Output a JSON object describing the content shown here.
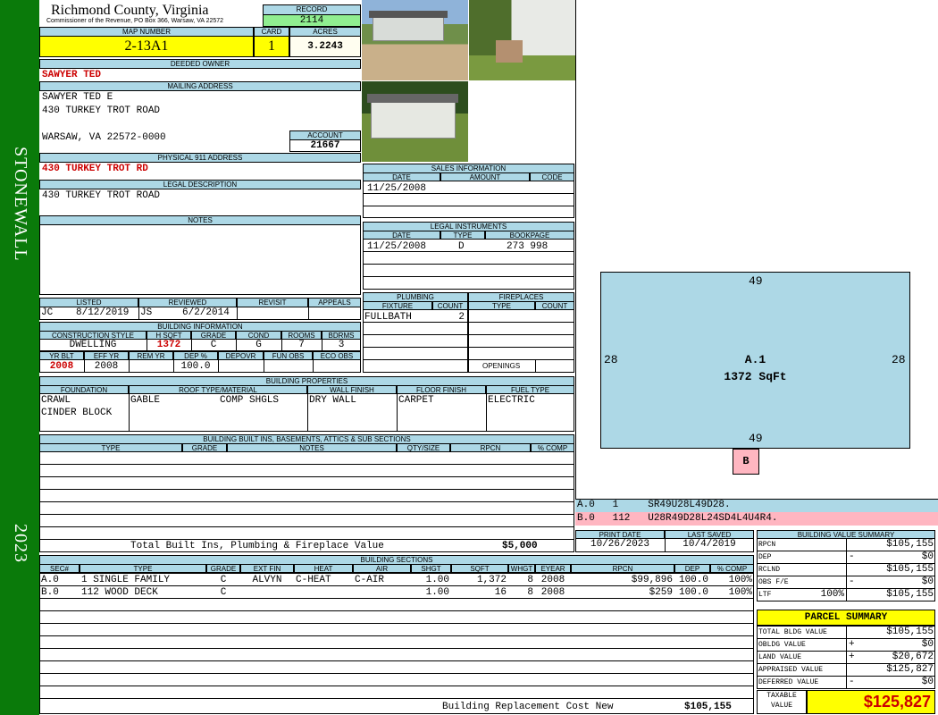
{
  "sidebar": {
    "district": "STONEWALL",
    "year": "2023"
  },
  "header": {
    "county": "Richmond County, Virginia",
    "commissioner": "Commissioner of the Revenue, PO Box 366, Warsaw, VA 22572",
    "record_label": "RECORD",
    "record": "2114",
    "map_number_label": "MAP NUMBER",
    "map_number": "2-13A1",
    "card_label": "CARD",
    "card": "1",
    "acres_label": "ACRES",
    "acres": "3.2243"
  },
  "owner": {
    "deeded_label": "DEEDED OWNER",
    "deeded_owner": "SAWYER TED",
    "mailing_label": "MAILING ADDRESS",
    "mailing_line1": "SAWYER TED E",
    "mailing_line2": "430 TURKEY TROT ROAD",
    "mailing_line3": "WARSAW, VA 22572-0000",
    "account_label": "ACCOUNT",
    "account": "21667",
    "physical_label": "PHYSICAL 911 ADDRESS",
    "physical": "430 TURKEY TROT RD",
    "legal_label": "LEGAL DESCRIPTION",
    "legal": "430 TURKEY TROT ROAD",
    "notes_label": "NOTES"
  },
  "sales": {
    "title": "SALES INFORMATION",
    "h_date": "DATE",
    "h_amount": "AMOUNT",
    "h_code": "CODE",
    "date1": "11/25/2008"
  },
  "legal_instruments": {
    "title": "LEGAL INSTRUMENTS",
    "h_date": "DATE",
    "h_type": "TYPE",
    "h_bookpage": "BOOKPAGE",
    "date1": "11/25/2008",
    "type1": "D",
    "bookpage1": "273 998"
  },
  "status": {
    "h_listed": "LISTED",
    "h_reviewed": "REVIEWED",
    "h_revisit": "REVISIT",
    "h_appeals": "APPEALS",
    "listed_by": "JC",
    "listed_date": "8/12/2019",
    "reviewed_by": "JS",
    "reviewed_date": "6/2/2014"
  },
  "building_info": {
    "title": "BUILDING INFORMATION",
    "h_style": "CONSTRUCTION STYLE",
    "h_hsqft": "H SQFT",
    "h_grade": "GRADE",
    "h_cond": "COND",
    "h_rooms": "ROOMS",
    "h_bdrms": "BDRMS",
    "style": "DWELLING",
    "hsqft": "1372",
    "grade": "C",
    "cond": "G",
    "rooms": "7",
    "bdrms": "3",
    "h_yrblt": "YR BLT",
    "h_effyr": "EFF YR",
    "h_remyr": "REM YR",
    "h_dep": "DEP %",
    "h_depovr": "DEPOVR",
    "h_funobs": "FUN OBS",
    "h_ecoobs": "ECO OBS",
    "yrblt": "2008",
    "effyr": "2008",
    "dep": "100.0"
  },
  "plumbing": {
    "title": "PLUMBING",
    "h_fixture": "FIXTURE",
    "h_count": "COUNT",
    "fixture1": "FULLBATH",
    "count1": "2"
  },
  "fireplaces": {
    "title": "FIREPLACES",
    "h_type": "TYPE",
    "h_count": "COUNT",
    "openings": "OPENINGS"
  },
  "properties": {
    "title": "BUILDING PROPERTIES",
    "h_foundation": "FOUNDATION",
    "h_roof": "ROOF TYPE/MATERIAL",
    "h_wall": "WALL FINISH",
    "h_floor": "FLOOR FINISH",
    "h_fuel": "FUEL TYPE",
    "foundation1": "CRAWL",
    "foundation2": "CINDER BLOCK",
    "roof_type": "GABLE",
    "roof_material": "COMP SHGLS",
    "wall": "DRY WALL",
    "floor": "CARPET",
    "fuel": "ELECTRIC"
  },
  "builtins": {
    "title": "BUILDING BUILT INS, BASEMENTS, ATTICS & SUB SECTIONS",
    "h_type": "TYPE",
    "h_grade": "GRADE",
    "h_notes": "NOTES",
    "h_qty": "QTY/SIZE",
    "h_rpcn": "RPCN",
    "h_comp": "% COMP",
    "total_label": "Total Built Ins, Plumbing & Fireplace Value",
    "total_value": "$5,000"
  },
  "dates": {
    "h_print": "PRINT DATE",
    "h_saved": "LAST SAVED",
    "print_date": "10/26/2023",
    "last_saved": "10/4/2019"
  },
  "sketch": {
    "top": "49",
    "bottom": "49",
    "left": "28",
    "right": "28",
    "label": "A.1",
    "area": "1372 SqFt",
    "deck_label": "B",
    "code_a": "A.0   1     SR49U28L49D28.",
    "code_b": "B.0   112   U28R49D28L24SD4L4U4R4.",
    "fill_color": "#add8e6",
    "deck_color": "#ffb6c1"
  },
  "sections": {
    "title": "BUILDING SECTIONS",
    "headers": [
      "SEC#",
      "TYPE",
      "GRADE",
      "EXT FIN",
      "HEAT",
      "AIR",
      "SHGT",
      "SQFT",
      "WHGT",
      "EYEAR",
      "RPCN",
      "DEP",
      "% COMP"
    ],
    "rows": [
      {
        "sec": "A.0",
        "type": "1 SINGLE FAMILY",
        "grade": "C",
        "extfin": "ALVYN",
        "heat": "C-HEAT",
        "air": "C-AIR",
        "shgt": "1.00",
        "sqft": "1,372",
        "whgt": "8",
        "eyear": "2008",
        "rpcn": "$99,896",
        "dep": "100.0",
        "comp": "100%"
      },
      {
        "sec": "B.0",
        "type": "112 WOOD DECK",
        "grade": "C",
        "extfin": "",
        "heat": "",
        "air": "",
        "shgt": "1.00",
        "sqft": "16",
        "whgt": "8",
        "eyear": "2008",
        "rpcn": "$259",
        "dep": "100.0",
        "comp": "100%"
      }
    ],
    "replacement_label": "Building Replacement Cost New",
    "replacement_value": "$105,155"
  },
  "value_summary": {
    "title": "BUILDING VALUE SUMMARY",
    "rpcn_label": "RPCN",
    "rpcn": "$105,155",
    "dep_label": "DEP",
    "dep_sign": "-",
    "dep": "$0",
    "rclnd_label": "RCLND",
    "rclnd": "$105,155",
    "obs_label": "OBS F/E",
    "obs_sign": "-",
    "obs": "$0",
    "ltf_label": "LTF",
    "ltf_pct": "100%",
    "ltf": "$105,155"
  },
  "parcel": {
    "title": "PARCEL SUMMARY",
    "total_bldg_label": "TOTAL BLDG VALUE",
    "total_bldg": "$105,155",
    "obldg_label": "OBLDG VALUE",
    "obldg_sign": "+",
    "obldg": "$0",
    "land_label": "LAND VALUE",
    "land_sign": "+",
    "land": "$20,672",
    "appraised_label": "APPRAISED VALUE",
    "appraised": "$125,827",
    "deferred_label": "DEFERRED VALUE",
    "deferred_sign": "-",
    "deferred": "$0",
    "taxable_label1": "TAXABLE",
    "taxable_label2": "VALUE",
    "taxable": "$125,827"
  }
}
